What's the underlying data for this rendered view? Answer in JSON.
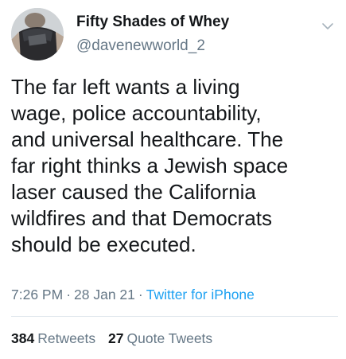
{
  "user": {
    "display_name": "Fifty Shades of Whey",
    "handle": "@davenewworld_2",
    "avatar_icon": "profile-photo"
  },
  "tweet": {
    "text": "The far left wants a living\nwage, police accountability,\nand universal healthcare. The\nfar right thinks a Jewish space\nlaser caused the California\nwildfires and that Democrats\nshould be executed."
  },
  "meta": {
    "time": "7:26 PM",
    "separator": "·",
    "date": "28 Jan 21",
    "source": "Twitter for iPhone"
  },
  "stats": {
    "retweets_count": "384",
    "retweets_label": "Retweets",
    "quotes_count": "27",
    "quotes_label": "Quote Tweets"
  },
  "colors": {
    "text": "#14171a",
    "secondary": "#657786",
    "link": "#1da1f2",
    "divider": "#e1e8ed"
  }
}
